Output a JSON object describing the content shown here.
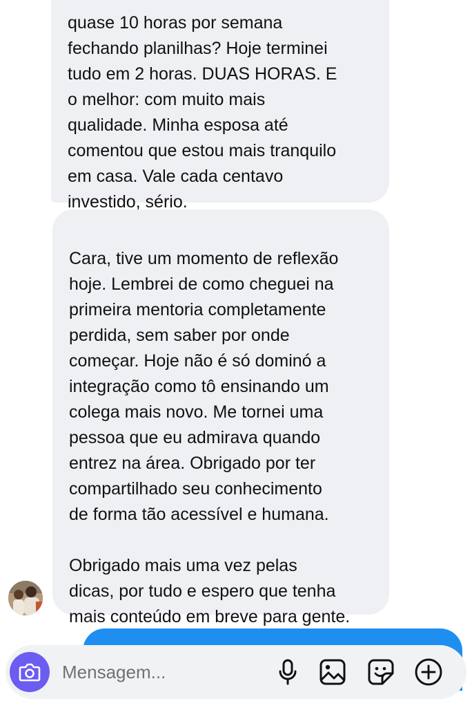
{
  "conversation": {
    "messages": [
      {
        "sender": "contact",
        "text": "quase 10 horas por semana\nfechando planilhas? Hoje terminei\ntudo em 2 horas. DUAS HORAS. E\no melhor: com muito mais\nqualidade. Minha esposa até\ncomentou que estou mais tranquilo\nem casa. Vale cada centavo\ninvestido, sério."
      },
      {
        "sender": "contact",
        "text": "Cara, tive um momento de reflexão\nhoje. Lembrei de como cheguei na\nprimeira mentoria completamente\nperdida, sem saber por onde\ncomeçar. Hoje não é só dominó a\nintegração como tô ensinando um\ncolega mais novo. Me tornei uma\npessoa que eu admirava quando\nentrez na área. Obrigado por ter\ncompartilhado seu conhecimento\nde forma tão acessível e humana.\n\nObrigado mais uma vez pelas\ndicas, por tudo e espero que tenha\nmais conteúdo em breve para gente."
      }
    ]
  },
  "composer": {
    "placeholder": "Mensagem...",
    "icons": [
      "camera-icon",
      "microphone-icon",
      "image-icon",
      "sticker-icon",
      "plus-icon"
    ]
  },
  "colors": {
    "received_bubble": "#eef0f3",
    "sent_bubble": "#1e8ff0",
    "camera_button": "#6b5cf2",
    "composer_background": "#f1f2f4"
  }
}
